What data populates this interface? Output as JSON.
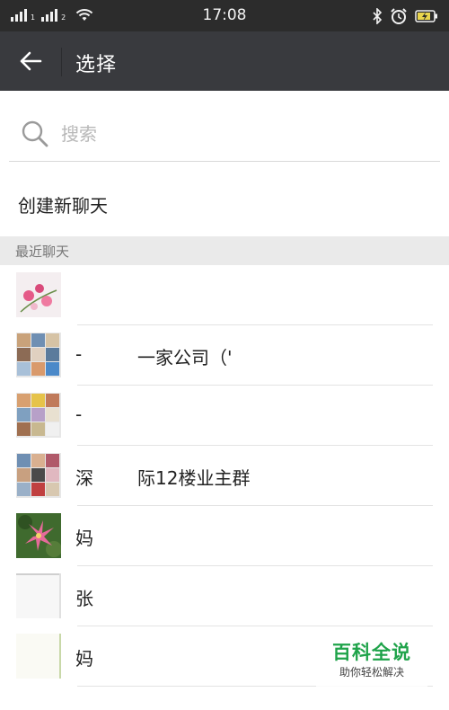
{
  "status_bar": {
    "time": "17:08",
    "signal_icons": [
      "signal-1-icon",
      "signal-2-icon"
    ],
    "wifi_icon": "wifi-icon",
    "right_icons": [
      "bluetooth-icon",
      "alarm-icon",
      "battery-charging-icon"
    ]
  },
  "title_bar": {
    "back_icon": "back-arrow-icon",
    "title": "选择"
  },
  "search": {
    "placeholder": "搜索",
    "value": ""
  },
  "new_chat": {
    "label": "创建新聊天"
  },
  "recent": {
    "header": "最近聊天",
    "items": [
      {
        "name": "",
        "name_cont": "",
        "avatar": "flower-photo-avatar"
      },
      {
        "name": "-",
        "name_cont": "一家公司（'",
        "avatar": "group-grid-avatar"
      },
      {
        "name": "-",
        "name_cont": "",
        "avatar": "group-grid-avatar"
      },
      {
        "name": "深",
        "name_cont": "际12楼业主群",
        "avatar": "group-grid-avatar"
      },
      {
        "name": "妈",
        "name_cont": "",
        "avatar": "lily-photo-avatar"
      },
      {
        "name": "张",
        "name_cont": "",
        "avatar": "photo-avatar"
      },
      {
        "name": "妈",
        "name_cont": "",
        "avatar": "photo-avatar"
      }
    ]
  },
  "watermark": {
    "title": "百科全说",
    "subtitle": "助你轻松解决"
  },
  "colors": {
    "status_bar": "#2c2c2c",
    "title_bar": "#393a3e",
    "section_header": "#eaeaea",
    "brand_green": "#1fa34a"
  }
}
